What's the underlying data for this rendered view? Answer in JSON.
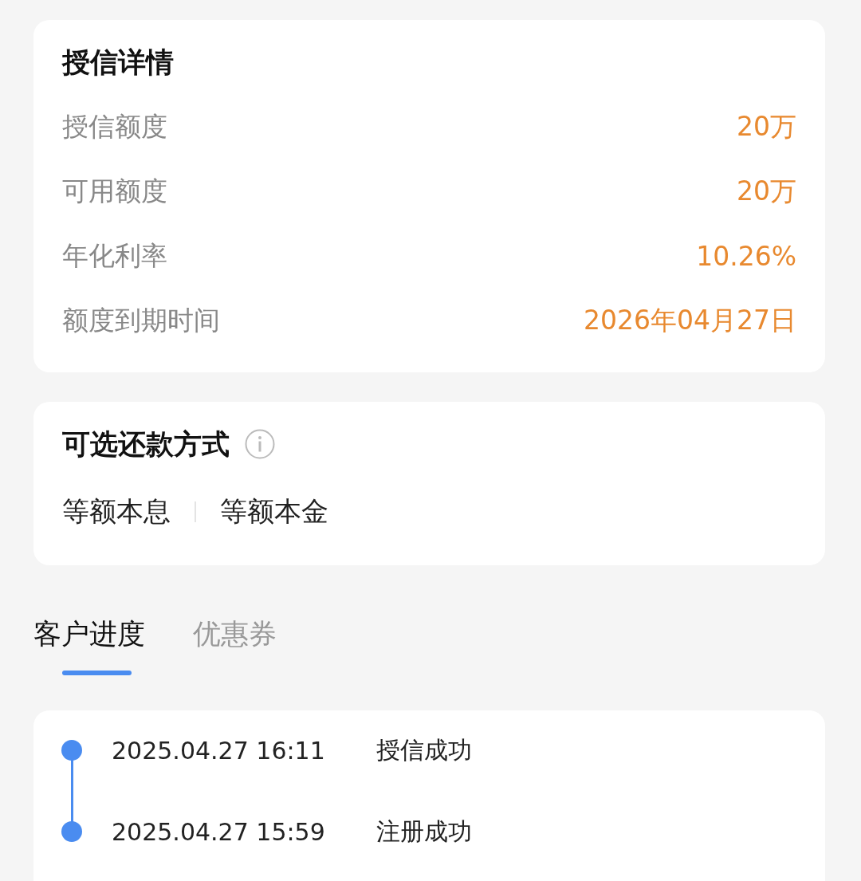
{
  "credit_details": {
    "title": "授信详情",
    "rows": [
      {
        "label": "授信额度",
        "value": "20万"
      },
      {
        "label": "可用额度",
        "value": "20万"
      },
      {
        "label": "年化利率",
        "value": "10.26%"
      },
      {
        "label": "额度到期时间",
        "value": "2026年04月27日"
      }
    ]
  },
  "repayment": {
    "title": "可选还款方式",
    "options": [
      "等额本息",
      "等额本金"
    ]
  },
  "tabs": [
    {
      "label": "客户进度",
      "selected": true
    },
    {
      "label": "优惠券",
      "selected": false
    }
  ],
  "progress": [
    {
      "time": "2025.04.27 16:11",
      "status": "授信成功"
    },
    {
      "time": "2025.04.27 15:59",
      "status": "注册成功"
    }
  ]
}
